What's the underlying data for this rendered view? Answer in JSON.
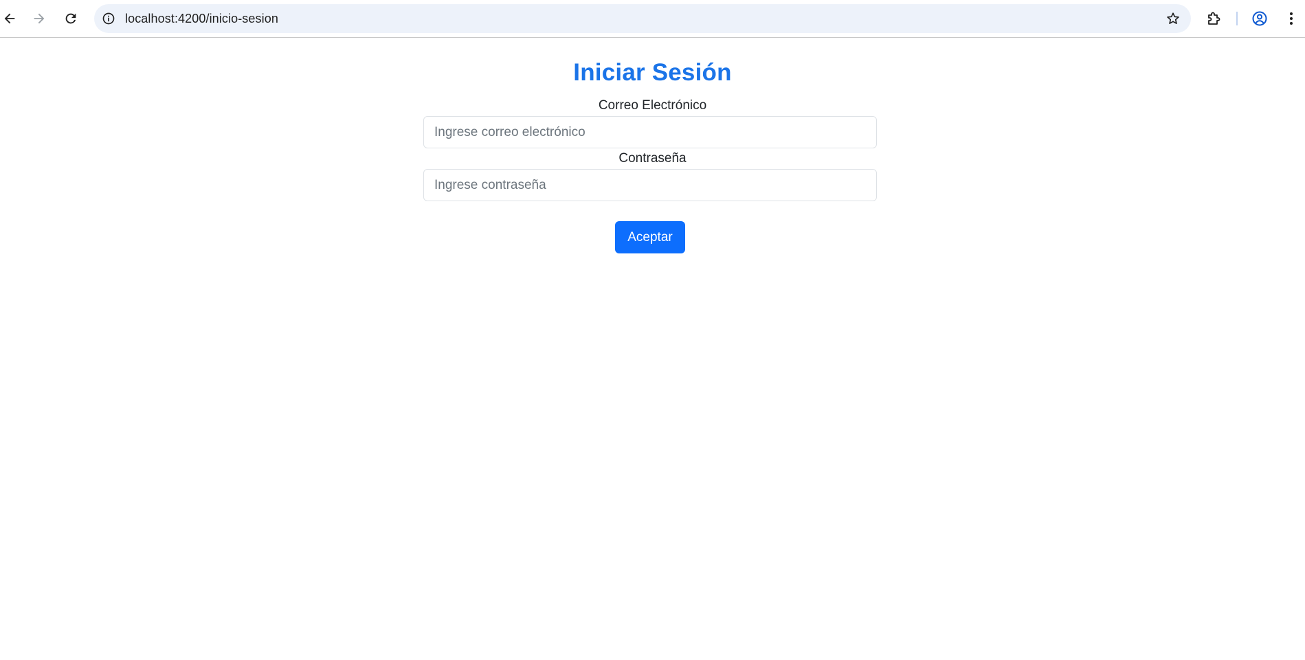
{
  "browser": {
    "url": "localhost:4200/inicio-sesion",
    "icons": {
      "back": "back-arrow-icon",
      "forward": "forward-arrow-icon",
      "reload": "reload-icon",
      "site_info": "info-icon",
      "bookmark": "star-icon",
      "extensions": "puzzle-icon",
      "profile": "profile-icon",
      "menu": "kebab-menu-icon"
    }
  },
  "login": {
    "title": "Iniciar Sesión",
    "email_label": "Correo Electrónico",
    "email_placeholder": "Ingrese correo electrónico",
    "password_label": "Contraseña",
    "password_placeholder": "Ingrese contraseña",
    "submit_label": "Aceptar"
  },
  "colors": {
    "title": "#1b74e8",
    "primary_button": "#0d6efd",
    "omnibox_bg": "#edf2fa"
  }
}
